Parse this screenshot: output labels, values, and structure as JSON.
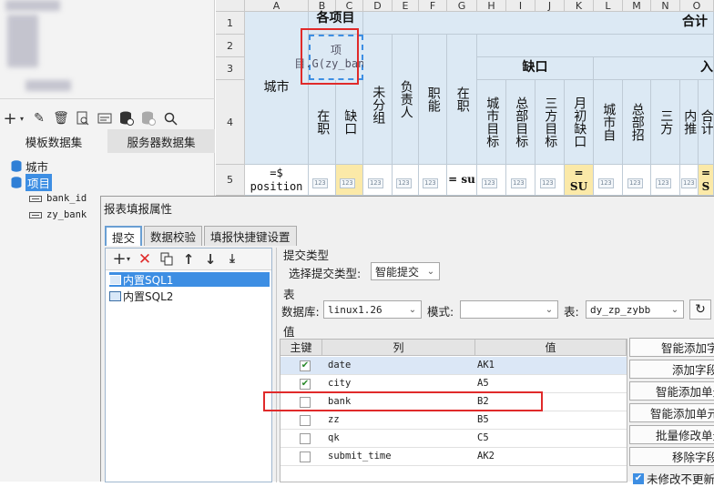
{
  "left_panel": {
    "toolbar_icons": [
      "plus-icon",
      "chevron-down-icon",
      "edit-icon",
      "trash-icon",
      "preview-icon",
      "dataset-icon",
      "db-add-icon",
      "db-gray-icon",
      "search-icon"
    ],
    "tabs": [
      "模板数据集",
      "服务器数据集"
    ],
    "tree": {
      "items": [
        {
          "label": "城市"
        },
        {
          "label": "项目",
          "selected": true
        }
      ],
      "fields": [
        "bank_id",
        "zy_bank"
      ]
    }
  },
  "sheet": {
    "col_headers": [
      "A",
      "B",
      "C",
      "D",
      "E",
      "F",
      "G",
      "H",
      "I",
      "J",
      "K",
      "L",
      "M",
      "N",
      "O"
    ],
    "row_headers": [
      "1",
      "2",
      "3",
      "4",
      "5"
    ],
    "cells": {
      "b1": "各项目",
      "b1_partial": "",
      "city": "城市",
      "total": "合计",
      "selected_cell": "项目.G(zy_bank)",
      "que_kou": "缺口",
      "ru": "入",
      "zai_zhi": "在职",
      "que_kou_c": "缺口",
      "wei_fen_zu": "未分组",
      "fu_ze_ren": "负责人",
      "zhi_neng": "职能",
      "zai_zhi2": "在职",
      "h4": "城市目标",
      "i4": "总部目标",
      "j4": "三方目标",
      "k4": "月初缺口",
      "l4": "城市自",
      "m4": "总部招",
      "n4": "三方",
      "o4": "内推",
      "p4": "合计",
      "a5": "=$ position",
      "g5": "= su",
      "k5": "= SU",
      "p5": "= S",
      "mini": "123"
    }
  },
  "dialog": {
    "title": "报表填报属性",
    "tabs": [
      "提交",
      "数据校验",
      "填报快捷键设置"
    ],
    "sql_items": [
      "内置SQL1",
      "内置SQL2"
    ],
    "submit_type_label": "提交类型",
    "select_submit_type_label": "选择提交类型:",
    "submit_type_value": "智能提交",
    "table_section": "表",
    "database_label": "数据库:",
    "database_value": "linux1.26",
    "schema_label": "模式:",
    "schema_value": "",
    "table_label": "表:",
    "table_value": "dy_zp_zybb",
    "value_section": "值",
    "grid_headers": [
      "主键",
      "列",
      "值"
    ],
    "rows": [
      {
        "column": "date",
        "value": "AK1",
        "checked": true
      },
      {
        "column": "city",
        "value": "A5",
        "checked": true
      },
      {
        "column": "bank",
        "value": "B2",
        "checked": false
      },
      {
        "column": "zz",
        "value": "B5",
        "checked": false
      },
      {
        "column": "qk",
        "value": "C5",
        "checked": false
      },
      {
        "column": "submit_time",
        "value": "AK2",
        "checked": false
      }
    ],
    "right_buttons": [
      "智能添加字",
      "添加字段",
      "智能添加单元",
      "智能添加单元",
      "批量修改单元",
      "移除字段"
    ],
    "bottom_checkbox": "未修改不更新",
    "colors": {
      "highlight_red": "#e02a2a",
      "selection_blue": "#3d8ee3",
      "cell_blue": "#dce9f4",
      "cell_yellow": "#fbe9a8"
    }
  }
}
